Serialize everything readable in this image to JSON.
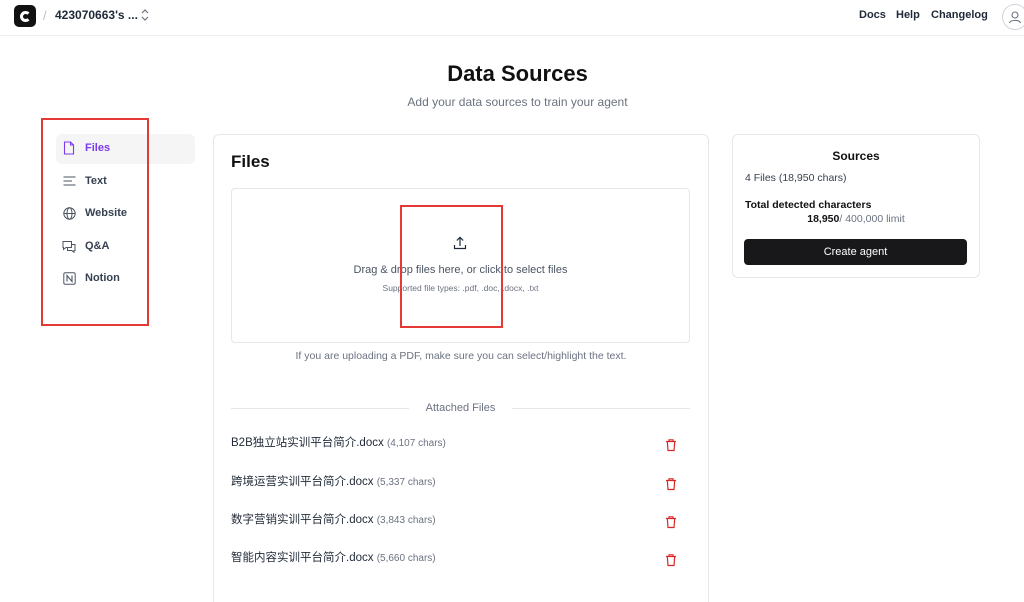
{
  "topbar": {
    "workspace_name": "423070663's ...",
    "nav": {
      "docs": "Docs",
      "help": "Help",
      "changelog": "Changelog"
    }
  },
  "header": {
    "title": "Data Sources",
    "subtitle": "Add your data sources to train your agent"
  },
  "sidebar": {
    "items": [
      {
        "label": "Files",
        "icon": "file-icon",
        "active": true
      },
      {
        "label": "Text",
        "icon": "text-lines-icon",
        "active": false
      },
      {
        "label": "Website",
        "icon": "globe-icon",
        "active": false
      },
      {
        "label": "Q&A",
        "icon": "chat-bubbles-icon",
        "active": false
      },
      {
        "label": "Notion",
        "icon": "notion-icon",
        "active": false
      }
    ]
  },
  "main": {
    "title": "Files",
    "dropzone": {
      "text": "Drag & drop files here, or click to select files",
      "types": "Supported file types: .pdf, .doc, .docx, .txt"
    },
    "pdf_note": "If you are uploading a PDF, make sure you can select/highlight the text.",
    "attached_label": "Attached Files",
    "files": [
      {
        "name": "B2B独立站实训平台简介.docx",
        "chars": "(4,107 chars)"
      },
      {
        "name": "跨境运营实训平台简介.docx",
        "chars": "(5,337 chars)"
      },
      {
        "name": "数字营销实训平台简介.docx",
        "chars": "(3,843 chars)"
      },
      {
        "name": "智能内容实训平台简介.docx",
        "chars": "(5,660 chars)"
      }
    ]
  },
  "sources": {
    "title": "Sources",
    "count": "4 Files (18,950 chars)",
    "total_label": "Total detected characters",
    "total_value": "18,950",
    "total_limit": "/ 400,000 limit",
    "create_label": "Create agent"
  },
  "colors": {
    "accent": "#7c3aed",
    "annotation": "#e53935",
    "trash": "#dc2626",
    "button": "#18181b"
  }
}
